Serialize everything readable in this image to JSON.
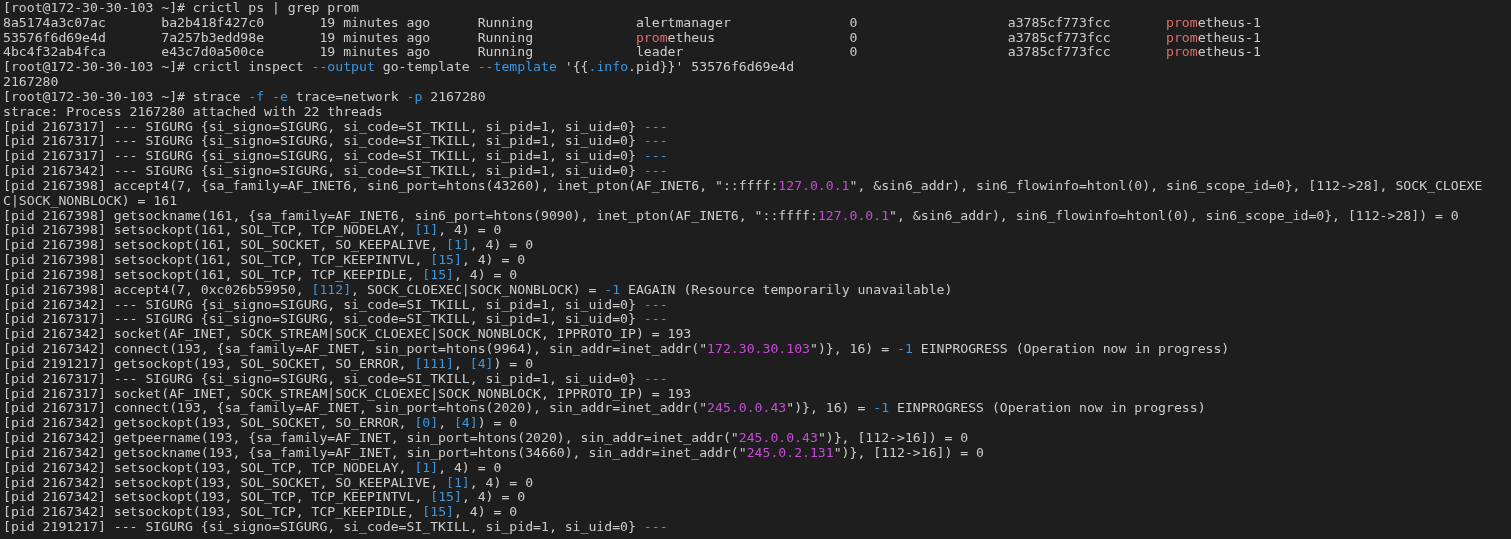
{
  "terminal": {
    "lines": [
      {
        "segments": [
          {
            "text": "[root@172-30-30-103 ~]# crictl ps | grep prom",
            "kind": "plain"
          }
        ]
      },
      {
        "segments": [
          {
            "text": "8a5174a3c07ac       ba2b418f427c0       19 minutes ago      Running             alertmanager               0                   a3785cf773fcc       ",
            "kind": "plain"
          },
          {
            "text": "prom",
            "kind": "match"
          },
          {
            "text": "etheus-1",
            "kind": "plain"
          }
        ]
      },
      {
        "segments": [
          {
            "text": "53576f6d69e4d       7a257b3edd98e       19 minutes ago      Running             ",
            "kind": "plain"
          },
          {
            "text": "prom",
            "kind": "match"
          },
          {
            "text": "etheus                 0                   a3785cf773fcc       ",
            "kind": "plain"
          },
          {
            "text": "prom",
            "kind": "match"
          },
          {
            "text": "etheus-1",
            "kind": "plain"
          }
        ]
      },
      {
        "segments": [
          {
            "text": "4bc4f32ab4fca       e43c7d0a500ce       19 minutes ago      Running             leader                     0                   a3785cf773fcc       ",
            "kind": "plain"
          },
          {
            "text": "prom",
            "kind": "match"
          },
          {
            "text": "etheus-1",
            "kind": "plain"
          }
        ]
      },
      {
        "segments": [
          {
            "text": "[root@172-30-30-103 ~]# crictl inspect ",
            "kind": "plain"
          },
          {
            "text": "--output",
            "kind": "option"
          },
          {
            "text": " go-template ",
            "kind": "plain"
          },
          {
            "text": "--template",
            "kind": "option"
          },
          {
            "text": " '{{",
            "kind": "plain"
          },
          {
            "text": ".info",
            "kind": "option"
          },
          {
            "text": ".pid}}' 53576f6d69e4d",
            "kind": "plain"
          }
        ]
      },
      {
        "segments": [
          {
            "text": "2167280",
            "kind": "plain"
          }
        ]
      },
      {
        "segments": [
          {
            "text": "[root@172-30-30-103 ~]# strace ",
            "kind": "plain"
          },
          {
            "text": "-f -e",
            "kind": "option"
          },
          {
            "text": " trace=network ",
            "kind": "plain"
          },
          {
            "text": "-p",
            "kind": "option"
          },
          {
            "text": " 2167280",
            "kind": "plain"
          }
        ]
      },
      {
        "segments": [
          {
            "text": "strace: Process 2167280 attached with 22 threads",
            "kind": "plain"
          }
        ]
      },
      {
        "segments": [
          {
            "text": "[pid 2167317] --- SIGURG {si_signo=SIGURG, si_code=SI_TKILL, si_pid=1, si_uid=0} ",
            "kind": "plain"
          },
          {
            "text": "---",
            "kind": "option"
          }
        ]
      },
      {
        "segments": [
          {
            "text": "[pid 2167317] --- SIGURG {si_signo=SIGURG, si_code=SI_TKILL, si_pid=1, si_uid=0} ",
            "kind": "plain"
          },
          {
            "text": "---",
            "kind": "option"
          }
        ]
      },
      {
        "segments": [
          {
            "text": "[pid 2167317] --- SIGURG {si_signo=SIGURG, si_code=SI_TKILL, si_pid=1, si_uid=0} ",
            "kind": "plain"
          },
          {
            "text": "---",
            "kind": "option"
          }
        ]
      },
      {
        "segments": [
          {
            "text": "[pid 2167342] --- SIGURG {si_signo=SIGURG, si_code=SI_TKILL, si_pid=1, si_uid=0} ",
            "kind": "plain"
          },
          {
            "text": "---",
            "kind": "option"
          }
        ]
      },
      {
        "segments": [
          {
            "text": "[pid 2167398] accept4(7, {sa_family=AF_INET6, sin6_port=htons(43260), inet_pton(AF_INET6, \"::ffff:",
            "kind": "plain"
          },
          {
            "text": "127.0.0.1",
            "kind": "address"
          },
          {
            "text": "\", &sin6_addr), sin6_flowinfo=htonl(0), sin6_scope_id=0}, [112->28], SOCK_CLOEXE",
            "kind": "plain"
          }
        ]
      },
      {
        "segments": [
          {
            "text": "C|SOCK_NONBLOCK) = 161",
            "kind": "plain"
          }
        ]
      },
      {
        "segments": [
          {
            "text": "[pid 2167398] getsockname(161, {sa_family=AF_INET6, sin6_port=htons(9090), inet_pton(AF_INET6, \"::ffff:",
            "kind": "plain"
          },
          {
            "text": "127.0.0.1",
            "kind": "address"
          },
          {
            "text": "\", &sin6_addr), sin6_flowinfo=htonl(0), sin6_scope_id=0}, [112->28]) = 0",
            "kind": "plain"
          }
        ]
      },
      {
        "segments": [
          {
            "text": "[pid 2167398] setsockopt(161, SOL_TCP, TCP_NODELAY, ",
            "kind": "plain"
          },
          {
            "text": "[1]",
            "kind": "number"
          },
          {
            "text": ", 4) = 0",
            "kind": "plain"
          }
        ]
      },
      {
        "segments": [
          {
            "text": "[pid 2167398] setsockopt(161, SOL_SOCKET, SO_KEEPALIVE, ",
            "kind": "plain"
          },
          {
            "text": "[1]",
            "kind": "number"
          },
          {
            "text": ", 4) = 0",
            "kind": "plain"
          }
        ]
      },
      {
        "segments": [
          {
            "text": "[pid 2167398] setsockopt(161, SOL_TCP, TCP_KEEPINTVL, ",
            "kind": "plain"
          },
          {
            "text": "[15]",
            "kind": "number"
          },
          {
            "text": ", 4) = 0",
            "kind": "plain"
          }
        ]
      },
      {
        "segments": [
          {
            "text": "[pid 2167398] setsockopt(161, SOL_TCP, TCP_KEEPIDLE, ",
            "kind": "plain"
          },
          {
            "text": "[15]",
            "kind": "number"
          },
          {
            "text": ", 4) = 0",
            "kind": "plain"
          }
        ]
      },
      {
        "segments": [
          {
            "text": "[pid 2167398] accept4(7, 0xc026b59950, ",
            "kind": "plain"
          },
          {
            "text": "[112]",
            "kind": "number"
          },
          {
            "text": ", SOCK_CLOEXEC|SOCK_NONBLOCK) = ",
            "kind": "plain"
          },
          {
            "text": "-1",
            "kind": "number"
          },
          {
            "text": " EAGAIN (Resource temporarily unavailable)",
            "kind": "plain"
          }
        ]
      },
      {
        "segments": [
          {
            "text": "[pid 2167342] --- SIGURG {si_signo=SIGURG, si_code=SI_TKILL, si_pid=1, si_uid=0} ",
            "kind": "plain"
          },
          {
            "text": "---",
            "kind": "option"
          }
        ]
      },
      {
        "segments": [
          {
            "text": "[pid 2167317] --- SIGURG {si_signo=SIGURG, si_code=SI_TKILL, si_pid=1, si_uid=0} ",
            "kind": "plain"
          },
          {
            "text": "---",
            "kind": "option"
          }
        ]
      },
      {
        "segments": [
          {
            "text": "[pid 2167342] socket(AF_INET, SOCK_STREAM|SOCK_CLOEXEC|SOCK_NONBLOCK, IPPROTO_IP) = 193",
            "kind": "plain"
          }
        ]
      },
      {
        "segments": [
          {
            "text": "[pid 2167342] connect(193, {sa_family=AF_INET, sin_port=htons(9964), sin_addr=inet_addr(\"",
            "kind": "plain"
          },
          {
            "text": "172.30.30.103",
            "kind": "address"
          },
          {
            "text": "\")}, 16) = ",
            "kind": "plain"
          },
          {
            "text": "-1",
            "kind": "number"
          },
          {
            "text": " EINPROGRESS (Operation now in progress)",
            "kind": "plain"
          }
        ]
      },
      {
        "segments": [
          {
            "text": "[pid 2191217] getsockopt(193, SOL_SOCKET, SO_ERROR, ",
            "kind": "plain"
          },
          {
            "text": "[111]",
            "kind": "number"
          },
          {
            "text": ", ",
            "kind": "plain"
          },
          {
            "text": "[4]",
            "kind": "number"
          },
          {
            "text": ") = 0",
            "kind": "plain"
          }
        ]
      },
      {
        "segments": [
          {
            "text": "[pid 2167317] --- SIGURG {si_signo=SIGURG, si_code=SI_TKILL, si_pid=1, si_uid=0} ",
            "kind": "plain"
          },
          {
            "text": "---",
            "kind": "option"
          }
        ]
      },
      {
        "segments": [
          {
            "text": "[pid 2167317] socket(AF_INET, SOCK_STREAM|SOCK_CLOEXEC|SOCK_NONBLOCK, IPPROTO_IP) = 193",
            "kind": "plain"
          }
        ]
      },
      {
        "segments": [
          {
            "text": "[pid 2167317] connect(193, {sa_family=AF_INET, sin_port=htons(2020), sin_addr=inet_addr(\"",
            "kind": "plain"
          },
          {
            "text": "245.0.0.43",
            "kind": "address"
          },
          {
            "text": "\")}, 16) = ",
            "kind": "plain"
          },
          {
            "text": "-1",
            "kind": "number"
          },
          {
            "text": " EINPROGRESS (Operation now in progress)",
            "kind": "plain"
          }
        ]
      },
      {
        "segments": [
          {
            "text": "[pid 2167342] getsockopt(193, SOL_SOCKET, SO_ERROR, ",
            "kind": "plain"
          },
          {
            "text": "[0]",
            "kind": "number"
          },
          {
            "text": ", ",
            "kind": "plain"
          },
          {
            "text": "[4]",
            "kind": "number"
          },
          {
            "text": ") = 0",
            "kind": "plain"
          }
        ]
      },
      {
        "segments": [
          {
            "text": "[pid 2167342] getpeername(193, {sa_family=AF_INET, sin_port=htons(2020), sin_addr=inet_addr(\"",
            "kind": "plain"
          },
          {
            "text": "245.0.0.43",
            "kind": "address"
          },
          {
            "text": "\")}, [112->16]) = 0",
            "kind": "plain"
          }
        ]
      },
      {
        "segments": [
          {
            "text": "[pid 2167342] getsockname(193, {sa_family=AF_INET, sin_port=htons(34660), sin_addr=inet_addr(\"",
            "kind": "plain"
          },
          {
            "text": "245.0.2.131",
            "kind": "address"
          },
          {
            "text": "\")}, [112->16]) = 0",
            "kind": "plain"
          }
        ]
      },
      {
        "segments": [
          {
            "text": "[pid 2167342] setsockopt(193, SOL_TCP, TCP_NODELAY, ",
            "kind": "plain"
          },
          {
            "text": "[1]",
            "kind": "number"
          },
          {
            "text": ", 4) = 0",
            "kind": "plain"
          }
        ]
      },
      {
        "segments": [
          {
            "text": "[pid 2167342] setsockopt(193, SOL_SOCKET, SO_KEEPALIVE, ",
            "kind": "plain"
          },
          {
            "text": "[1]",
            "kind": "number"
          },
          {
            "text": ", 4) = 0",
            "kind": "plain"
          }
        ]
      },
      {
        "segments": [
          {
            "text": "[pid 2167342] setsockopt(193, SOL_TCP, TCP_KEEPINTVL, ",
            "kind": "plain"
          },
          {
            "text": "[15]",
            "kind": "number"
          },
          {
            "text": ", 4) = 0",
            "kind": "plain"
          }
        ]
      },
      {
        "segments": [
          {
            "text": "[pid 2167342] setsockopt(193, SOL_TCP, TCP_KEEPIDLE, ",
            "kind": "plain"
          },
          {
            "text": "[15]",
            "kind": "number"
          },
          {
            "text": ", 4) = 0",
            "kind": "plain"
          }
        ]
      },
      {
        "segments": [
          {
            "text": "[pid 2191217] --- SIGURG {si_signo=SIGURG, si_code=SI_TKILL, si_pid=1, si_uid=0} ",
            "kind": "plain"
          },
          {
            "text": "---",
            "kind": "option"
          }
        ]
      }
    ]
  }
}
